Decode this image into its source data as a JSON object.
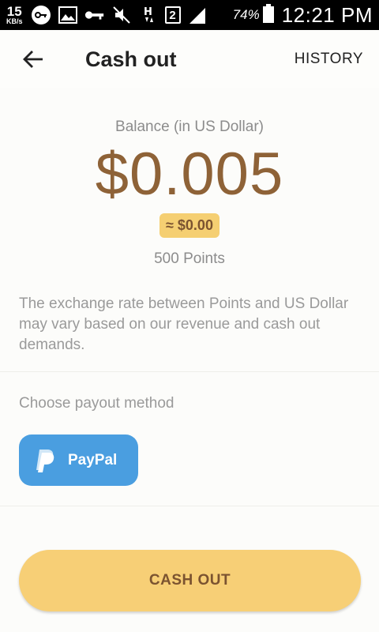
{
  "status_bar": {
    "net_speed": "15",
    "net_speed_unit": "KB/s",
    "sim_slot": "2",
    "battery_percent": "74%",
    "time": "12:21 PM"
  },
  "app_bar": {
    "title": "Cash out",
    "history_label": "HISTORY"
  },
  "balance": {
    "label": "Balance (in US Dollar)",
    "amount": "$0.005",
    "approx": "≈ $0.00",
    "points": "500 Points"
  },
  "exchange_note": "The exchange rate between Points and US Dollar may vary based on our revenue and cash out demands.",
  "payout": {
    "label": "Choose payout method",
    "methods": [
      {
        "label": "PayPal",
        "icon": "paypal-icon"
      }
    ]
  },
  "cashout_button_label": "CASH OUT",
  "colors": {
    "accent": "#f7cf76",
    "amount_brown": "#8e6237",
    "paypal_blue": "#4a9ee0"
  }
}
